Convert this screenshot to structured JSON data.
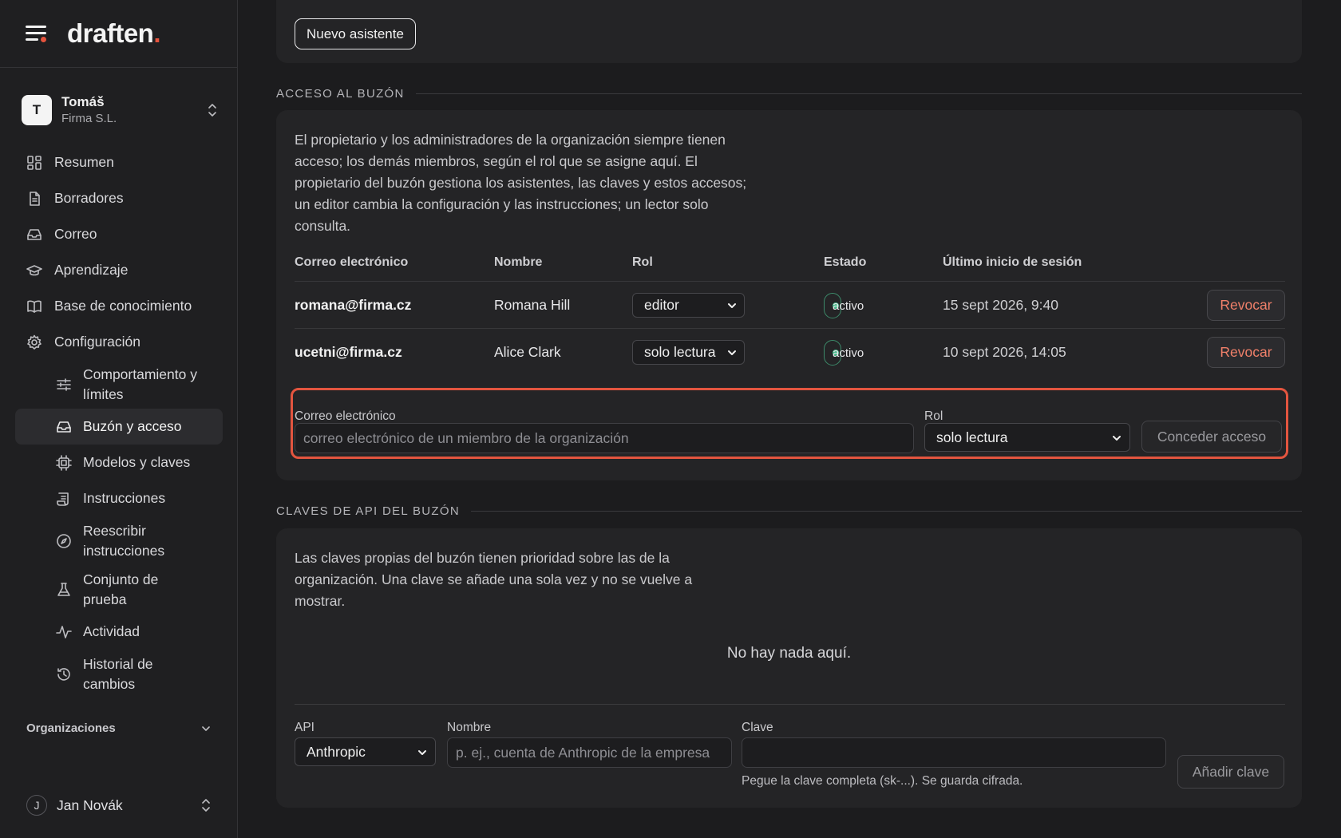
{
  "brand": {
    "name": "draften",
    "accent": "."
  },
  "account": {
    "initial": "T",
    "name": "Tomáš",
    "org": "Firma S.L."
  },
  "nav": {
    "items": [
      {
        "label": "Resumen",
        "icon": "dashboard-icon"
      },
      {
        "label": "Borradores",
        "icon": "document-icon"
      },
      {
        "label": "Correo",
        "icon": "inbox-icon"
      },
      {
        "label": "Aprendizaje",
        "icon": "graduation-cap-icon"
      },
      {
        "label": "Base de conocimiento",
        "icon": "book-open-icon"
      },
      {
        "label": "Configuración",
        "icon": "gear-icon"
      }
    ],
    "sub": [
      {
        "label": "Comportamiento y límites",
        "icon": "sliders-icon"
      },
      {
        "label": "Buzón y acceso",
        "icon": "inbox-icon",
        "active": true
      },
      {
        "label": "Modelos y claves",
        "icon": "cpu-icon"
      },
      {
        "label": "Instrucciones",
        "icon": "scroll-icon"
      },
      {
        "label": "Reescribir instrucciones",
        "icon": "compass-icon"
      },
      {
        "label": "Conjunto de prueba",
        "icon": "flask-icon"
      },
      {
        "label": "Actividad",
        "icon": "activity-icon"
      },
      {
        "label": "Historial de cambios",
        "icon": "history-icon"
      }
    ],
    "organizations": "Organizaciones"
  },
  "user": {
    "initial": "J",
    "name": "Jan Novák"
  },
  "top_card": {
    "new_assistant": "Nuevo asistente"
  },
  "access": {
    "title": "ACCESO AL BUZÓN",
    "description": "El propietario y los administradores de la organización siempre tienen acceso; los demás miembros, según el rol que se asigne aquí. El propietario del buzón gestiona los asistentes, las claves y estos accesos; un editor cambia la configuración y las instrucciones; un lector solo consulta.",
    "columns": [
      "Correo electrónico",
      "Nombre",
      "Rol",
      "Estado",
      "Último inicio de sesión"
    ],
    "rows": [
      {
        "email": "romana@firma.cz",
        "name": "Romana Hill",
        "role": "editor",
        "status": "activo",
        "last_login": "15 sept 2026, 9:40",
        "action": "Revocar"
      },
      {
        "email": "ucetni@firma.cz",
        "name": "Alice Clark",
        "role": "solo lectura",
        "status": "activo",
        "last_login": "10 sept 2026, 14:05",
        "action": "Revocar"
      }
    ],
    "grant": {
      "email_label": "Correo electrónico",
      "email_placeholder": "correo electrónico de un miembro de la organización",
      "role_label": "Rol",
      "role_value": "solo lectura",
      "button": "Conceder acceso"
    }
  },
  "keys": {
    "title": "CLAVES DE API DEL BUZÓN",
    "description": "Las claves propias del buzón tienen prioridad sobre las de la organización. Una clave se añade una sola vez y no se vuelve a mostrar.",
    "empty": "No hay nada aquí.",
    "api_label": "API",
    "api_value": "Anthropic",
    "name_label": "Nombre",
    "name_placeholder": "p. ej., cuenta de Anthropic de la empresa",
    "key_label": "Clave",
    "key_value": "",
    "key_hint": "Pegue la clave completa (sk-...). Se guarda cifrada.",
    "add_button": "Añadir clave"
  },
  "colors": {
    "accent": "#e5533d",
    "status": "#46b98a",
    "revoke": "#f0806a"
  }
}
